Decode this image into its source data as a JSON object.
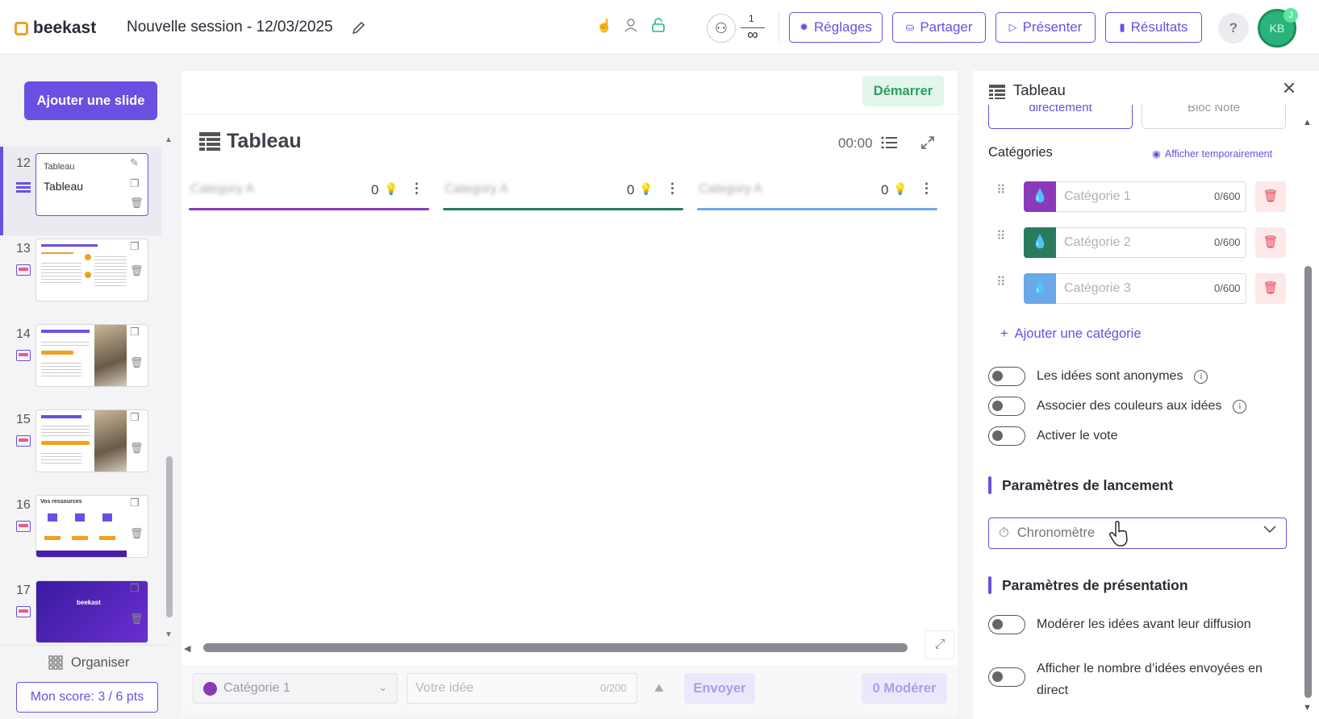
{
  "header": {
    "logo_text": "beekast",
    "session_title": "Nouvelle session - 12/03/2025",
    "participants_count": "1",
    "participants_max": "∞",
    "buttons": {
      "settings": "Réglages",
      "share": "Partager",
      "present": "Présenter",
      "results": "Résultats"
    },
    "help": "?",
    "avatar_initials": "KB",
    "avatar_badge": "J"
  },
  "sidebar": {
    "add_slide": "Ajouter une slide",
    "slides": [
      {
        "number": "12",
        "label": "Tableau",
        "title": "Tableau",
        "active": true
      },
      {
        "number": "13"
      },
      {
        "number": "14"
      },
      {
        "number": "15"
      },
      {
        "number": "16",
        "thumb_text": "Vos ressources"
      },
      {
        "number": "17",
        "thumb_text": "beekast"
      }
    ],
    "organise": "Organiser",
    "score": "Mon score: 3 / 6 pts"
  },
  "board": {
    "start": "Démarrer",
    "title": "Tableau",
    "timer": "00:00",
    "columns": [
      {
        "name": "Category A",
        "count": "0",
        "color": "#8a3ab9"
      },
      {
        "name": "Category A",
        "count": "0",
        "color": "#2a7a5e"
      },
      {
        "name": "Category A",
        "count": "0",
        "color": "#6aa8e8"
      }
    ],
    "compose": {
      "category": "Catégorie 1",
      "idea_placeholder": "Votre idée",
      "idea_count": "0/200",
      "send": "Envoyer",
      "moderate": "0 Modérer"
    }
  },
  "panel": {
    "title": "Tableau",
    "tab_a": "directement",
    "tab_b": "Bloc Note",
    "categories_label": "Catégories",
    "show_temp": "Afficher temporairement",
    "categories": [
      {
        "placeholder": "Catégorie 1",
        "count": "0/600",
        "color": "#8a3ab9"
      },
      {
        "placeholder": "Catégorie 2",
        "count": "0/600",
        "color": "#2a7a5e"
      },
      {
        "placeholder": "Catégorie 3",
        "count": "0/600",
        "color": "#6aa8e8"
      }
    ],
    "add_category": "Ajouter une catégorie",
    "toggles": {
      "anonymous": "Les idées sont anonymes",
      "colors": "Associer des couleurs aux idées",
      "vote": "Activer le vote",
      "moderate": "Modérer les idées avant leur diffusion",
      "show_count": "Afficher le nombre d’idées envoyées en direct"
    },
    "launch_heading": "Paramètres de lancement",
    "launch_value": "Chronomètre",
    "presentation_heading": "Paramètres de présentation"
  }
}
